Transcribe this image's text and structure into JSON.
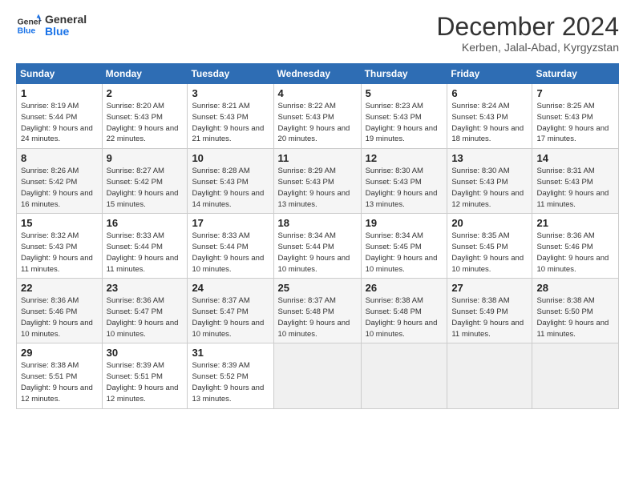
{
  "header": {
    "logo_line1": "General",
    "logo_line2": "Blue",
    "month": "December 2024",
    "location": "Kerben, Jalal-Abad, Kyrgyzstan"
  },
  "columns": [
    "Sunday",
    "Monday",
    "Tuesday",
    "Wednesday",
    "Thursday",
    "Friday",
    "Saturday"
  ],
  "weeks": [
    [
      {
        "day": "1",
        "rise": "8:19 AM",
        "set": "5:44 PM",
        "daylight": "9 hours and 24 minutes."
      },
      {
        "day": "2",
        "rise": "8:20 AM",
        "set": "5:43 PM",
        "daylight": "9 hours and 22 minutes."
      },
      {
        "day": "3",
        "rise": "8:21 AM",
        "set": "5:43 PM",
        "daylight": "9 hours and 21 minutes."
      },
      {
        "day": "4",
        "rise": "8:22 AM",
        "set": "5:43 PM",
        "daylight": "9 hours and 20 minutes."
      },
      {
        "day": "5",
        "rise": "8:23 AM",
        "set": "5:43 PM",
        "daylight": "9 hours and 19 minutes."
      },
      {
        "day": "6",
        "rise": "8:24 AM",
        "set": "5:43 PM",
        "daylight": "9 hours and 18 minutes."
      },
      {
        "day": "7",
        "rise": "8:25 AM",
        "set": "5:43 PM",
        "daylight": "9 hours and 17 minutes."
      }
    ],
    [
      {
        "day": "8",
        "rise": "8:26 AM",
        "set": "5:42 PM",
        "daylight": "9 hours and 16 minutes."
      },
      {
        "day": "9",
        "rise": "8:27 AM",
        "set": "5:42 PM",
        "daylight": "9 hours and 15 minutes."
      },
      {
        "day": "10",
        "rise": "8:28 AM",
        "set": "5:43 PM",
        "daylight": "9 hours and 14 minutes."
      },
      {
        "day": "11",
        "rise": "8:29 AM",
        "set": "5:43 PM",
        "daylight": "9 hours and 13 minutes."
      },
      {
        "day": "12",
        "rise": "8:30 AM",
        "set": "5:43 PM",
        "daylight": "9 hours and 13 minutes."
      },
      {
        "day": "13",
        "rise": "8:30 AM",
        "set": "5:43 PM",
        "daylight": "9 hours and 12 minutes."
      },
      {
        "day": "14",
        "rise": "8:31 AM",
        "set": "5:43 PM",
        "daylight": "9 hours and 11 minutes."
      }
    ],
    [
      {
        "day": "15",
        "rise": "8:32 AM",
        "set": "5:43 PM",
        "daylight": "9 hours and 11 minutes."
      },
      {
        "day": "16",
        "rise": "8:33 AM",
        "set": "5:44 PM",
        "daylight": "9 hours and 11 minutes."
      },
      {
        "day": "17",
        "rise": "8:33 AM",
        "set": "5:44 PM",
        "daylight": "9 hours and 10 minutes."
      },
      {
        "day": "18",
        "rise": "8:34 AM",
        "set": "5:44 PM",
        "daylight": "9 hours and 10 minutes."
      },
      {
        "day": "19",
        "rise": "8:34 AM",
        "set": "5:45 PM",
        "daylight": "9 hours and 10 minutes."
      },
      {
        "day": "20",
        "rise": "8:35 AM",
        "set": "5:45 PM",
        "daylight": "9 hours and 10 minutes."
      },
      {
        "day": "21",
        "rise": "8:36 AM",
        "set": "5:46 PM",
        "daylight": "9 hours and 10 minutes."
      }
    ],
    [
      {
        "day": "22",
        "rise": "8:36 AM",
        "set": "5:46 PM",
        "daylight": "9 hours and 10 minutes."
      },
      {
        "day": "23",
        "rise": "8:36 AM",
        "set": "5:47 PM",
        "daylight": "9 hours and 10 minutes."
      },
      {
        "day": "24",
        "rise": "8:37 AM",
        "set": "5:47 PM",
        "daylight": "9 hours and 10 minutes."
      },
      {
        "day": "25",
        "rise": "8:37 AM",
        "set": "5:48 PM",
        "daylight": "9 hours and 10 minutes."
      },
      {
        "day": "26",
        "rise": "8:38 AM",
        "set": "5:48 PM",
        "daylight": "9 hours and 10 minutes."
      },
      {
        "day": "27",
        "rise": "8:38 AM",
        "set": "5:49 PM",
        "daylight": "9 hours and 11 minutes."
      },
      {
        "day": "28",
        "rise": "8:38 AM",
        "set": "5:50 PM",
        "daylight": "9 hours and 11 minutes."
      }
    ],
    [
      {
        "day": "29",
        "rise": "8:38 AM",
        "set": "5:51 PM",
        "daylight": "9 hours and 12 minutes."
      },
      {
        "day": "30",
        "rise": "8:39 AM",
        "set": "5:51 PM",
        "daylight": "9 hours and 12 minutes."
      },
      {
        "day": "31",
        "rise": "8:39 AM",
        "set": "5:52 PM",
        "daylight": "9 hours and 13 minutes."
      },
      null,
      null,
      null,
      null
    ]
  ]
}
